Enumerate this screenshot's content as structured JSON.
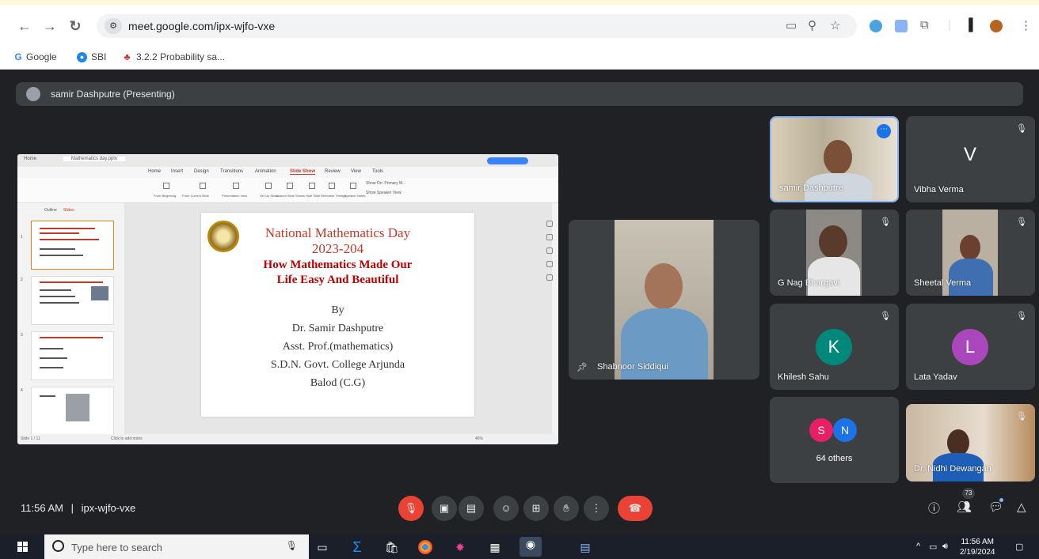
{
  "browser": {
    "url": "meet.google.com/ipx-wjfo-vxe",
    "bookmarks": [
      {
        "label": "Google",
        "icon": "google-icon"
      },
      {
        "label": "SBI",
        "icon": "sbi-icon"
      },
      {
        "label": "3.2.2 Probability sa...",
        "icon": "maple-leaf-icon"
      }
    ]
  },
  "meet": {
    "presenting_label": "samir Dashputre (Presenting)",
    "meeting_time": "11:56 AM",
    "separator": "|",
    "meeting_code": "ipx-wjfo-vxe",
    "participants_count": "73",
    "participants": [
      {
        "name": "samir Dashputre",
        "type": "video"
      },
      {
        "name": "Vibha Verma",
        "type": "avatar",
        "letter": "V",
        "color": "#3c4043",
        "muted": true
      },
      {
        "name": "G Nag Bhargavi",
        "type": "video",
        "muted": true
      },
      {
        "name": "Sheetal Verma",
        "type": "video",
        "muted": true
      },
      {
        "name": "Khilesh Sahu",
        "type": "avatar",
        "letter": "K",
        "color": "#00897b",
        "muted": true
      },
      {
        "name": "Lata Yadav",
        "type": "avatar",
        "letter": "L",
        "color": "#ab47bc",
        "muted": true
      },
      {
        "name": "Dr. Nidhi Dewangan",
        "type": "video",
        "muted": true
      },
      {
        "name": "Shabnoor Siddiqui",
        "type": "video",
        "pinned": true
      }
    ],
    "others": {
      "label": "64 others",
      "letters": [
        "S",
        "N"
      ],
      "colors": [
        "#e91e63",
        "#1a73e8"
      ]
    },
    "colors": {
      "end_call": "#ea4335",
      "mic_off": "#ea4335",
      "surface": "#3c4043",
      "background": "#202124"
    }
  },
  "slide": {
    "line1": "National Mathematics Day",
    "line2": "2023-204",
    "line3": "How  Mathematics Made  Our",
    "line4": "Life Easy And Beautiful",
    "line5": "By",
    "line6": "Dr. Samir Dashputre",
    "line7": "Asst. Prof.(mathematics)",
    "line8": "S.D.N. Govt. College Arjunda",
    "line9": "Balod (C.G)"
  },
  "ppt": {
    "tabs": [
      "Home",
      "Mathematics day.pptx"
    ],
    "menus": [
      "Home",
      "Insert",
      "Design",
      "Transitions",
      "Animation",
      "Slide Show",
      "Review",
      "View",
      "Tools"
    ],
    "active_menu": "Slide Show",
    "ribbon": [
      "From Beginning",
      "From Current Slide",
      "Presentation View",
      "Set Up Show",
      "Custom Slide Shows",
      "Hide Slide",
      "Rehearse Timings",
      "Speaker Notes"
    ],
    "show_on": "Show On:  Primary M...",
    "show_speaker_view": "Show Speaker View",
    "panel_tabs": [
      "Outline",
      "Slides"
    ],
    "slide_numbers": [
      "1",
      "2",
      "3",
      "4"
    ],
    "status_left": "Slide 1 / 11",
    "notes_placeholder": "Click to add notes",
    "zoom": "46%"
  },
  "taskbar": {
    "search_placeholder": "Type here to search",
    "time": "11:56 AM",
    "date": "2/19/2024"
  }
}
